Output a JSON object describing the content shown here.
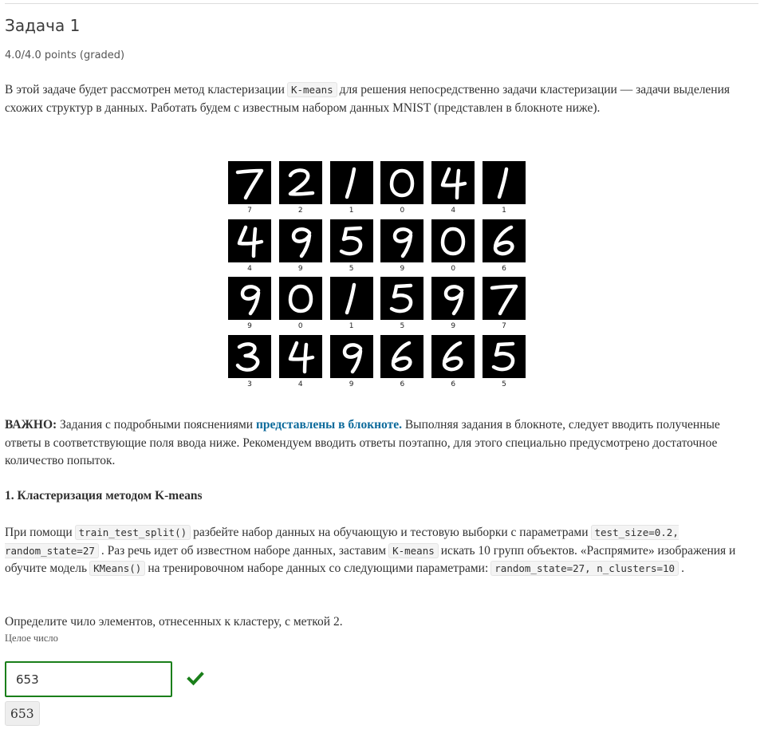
{
  "problem": {
    "title": "Задача 1",
    "score": "4.0/4.0 points (graded)"
  },
  "intro": {
    "part1": "В этой задаче будет рассмотрен метод кластеризации",
    "code1": "K-means",
    "part2": "для решения непосредственно задачи кластеризации — задачи выделения схожих структур в данных. Работать будем с известным набором данных MNIST (представлен в блокноте ниже)."
  },
  "figure": {
    "digits": [
      {
        "label": "7"
      },
      {
        "label": "2"
      },
      {
        "label": "1"
      },
      {
        "label": "0"
      },
      {
        "label": "4"
      },
      {
        "label": "1"
      },
      {
        "label": "4"
      },
      {
        "label": "9"
      },
      {
        "label": "5"
      },
      {
        "label": "9"
      },
      {
        "label": "0"
      },
      {
        "label": "6"
      },
      {
        "label": "9"
      },
      {
        "label": "0"
      },
      {
        "label": "1"
      },
      {
        "label": "5"
      },
      {
        "label": "9"
      },
      {
        "label": "7"
      },
      {
        "label": "3"
      },
      {
        "label": "4"
      },
      {
        "label": "9"
      },
      {
        "label": "6"
      },
      {
        "label": "6"
      },
      {
        "label": "5"
      }
    ]
  },
  "important": {
    "bold": "ВАЖНО:",
    "text1": "Задания с подробными пояснениями",
    "link": "представлены в блокноте.",
    "text2": "Выполняя задания в блокноте, следует вводить полученные ответы в соответствующие поля ввода ниже. Рекомендуем вводить ответы поэтапно, для этого специально предусмотрено достаточное количество попыток."
  },
  "section": {
    "title": "1. Кластеризация методом K-means"
  },
  "instructions": {
    "t1": "При помощи",
    "c1": "train_test_split()",
    "t2": "разбейте набор данных на обучающую и тестовую выборки с параметрами",
    "c2": "test_size=0.2, random_state=27",
    "t3": ". Раз речь идет об известном наборе данных, заставим",
    "c3": "K-means",
    "t4": "искать 10 групп объектов. «Распрямите» изображения и обучите модель",
    "c4": "KMeans()",
    "t5": "на тренировочном наборе данных со следующими параметрами:",
    "c5": "random_state=27, n_clusters=10",
    "t6": "."
  },
  "question": {
    "text": "Определите чило элементов, отнесенных к кластеру, с меткой 2.",
    "hint": "Целое число"
  },
  "answer": {
    "value": "653",
    "submitted": "653",
    "status_icon": "checkmark-icon",
    "status_color": "#1a7f1a"
  }
}
